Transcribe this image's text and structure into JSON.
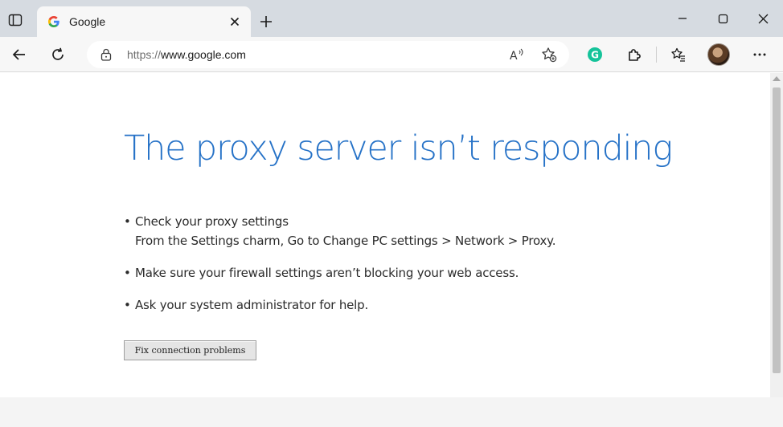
{
  "tab": {
    "title": "Google",
    "favicon_letter": "G",
    "favicon_color": "#4285f4"
  },
  "address": {
    "protocol": "https://",
    "host": "www.google.com"
  },
  "icons": {
    "tab_actions": "tab-actions-icon",
    "close": "close-icon",
    "new_tab": "plus-icon",
    "minimize": "minimize-icon",
    "maximize": "maximize-icon",
    "window_close": "close-icon",
    "back": "back-arrow-icon",
    "refresh": "refresh-icon",
    "lock": "lock-icon",
    "read_aloud": "read-aloud-icon",
    "add_favorite": "add-favorite-icon",
    "grammarly": "grammarly-icon",
    "extensions": "extensions-icon",
    "favorites": "favorites-icon",
    "profile": "avatar",
    "more": "more-icon"
  },
  "grammarly_color": "#15c39a",
  "error": {
    "title": "The proxy server isn’t responding",
    "title_color": "#2672c7",
    "bullets": [
      {
        "text": "Check your proxy settings",
        "sub": "From the Settings charm, Go to Change PC settings > Network > Proxy."
      },
      {
        "text": "Make sure your firewall settings aren’t blocking your web access."
      },
      {
        "text": "Ask your system administrator for help."
      }
    ],
    "fix_button": "Fix connection problems"
  }
}
